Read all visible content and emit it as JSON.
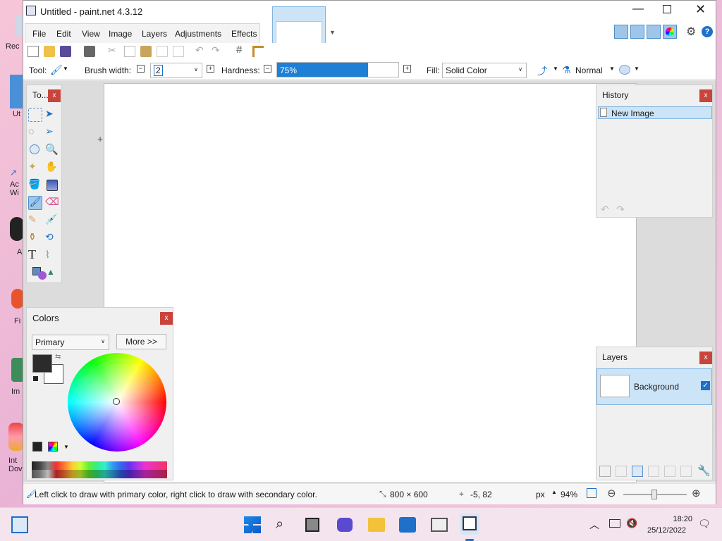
{
  "window": {
    "title": "Untitled - paint.net 4.3.12",
    "controls": [
      "minimize",
      "maximize",
      "close"
    ]
  },
  "menu": [
    "File",
    "Edit",
    "View",
    "Image",
    "Layers",
    "Adjustments",
    "Effects"
  ],
  "tool_options": {
    "tool_label": "Tool:",
    "brush_width_label": "Brush width:",
    "brush_width_value": "2",
    "hardness_label": "Hardness:",
    "hardness_value": "75%",
    "hardness_fraction": 0.75,
    "fill_label": "Fill:",
    "fill_value": "Solid Color",
    "blend_value": "Normal"
  },
  "tools_panel": {
    "title": "To..."
  },
  "history_panel": {
    "title": "History",
    "items": [
      "New Image"
    ]
  },
  "colors_panel": {
    "title": "Colors",
    "mode_value": "Primary",
    "more_label": "More >>"
  },
  "layers_panel": {
    "title": "Layers",
    "layers": [
      {
        "name": "Background",
        "visible": true
      }
    ]
  },
  "status": {
    "hint": "Left click to draw with primary color, right click to draw with secondary color.",
    "image_size": "800 × 600",
    "cursor_pos": "-5, 82",
    "unit": "px",
    "zoom": "94%"
  },
  "taskbar": {
    "time": "18:20",
    "date": "25/12/2022"
  },
  "desktop_labels": [
    "Rec",
    "Ut",
    "Ac\nWi",
    "A",
    "Fi",
    "Im",
    "Int\nDov"
  ],
  "colors": {
    "accent": "#0078d7",
    "close_red": "#c9453c",
    "primary_color": "#2b2b2b",
    "secondary_color": "#ffffff"
  }
}
